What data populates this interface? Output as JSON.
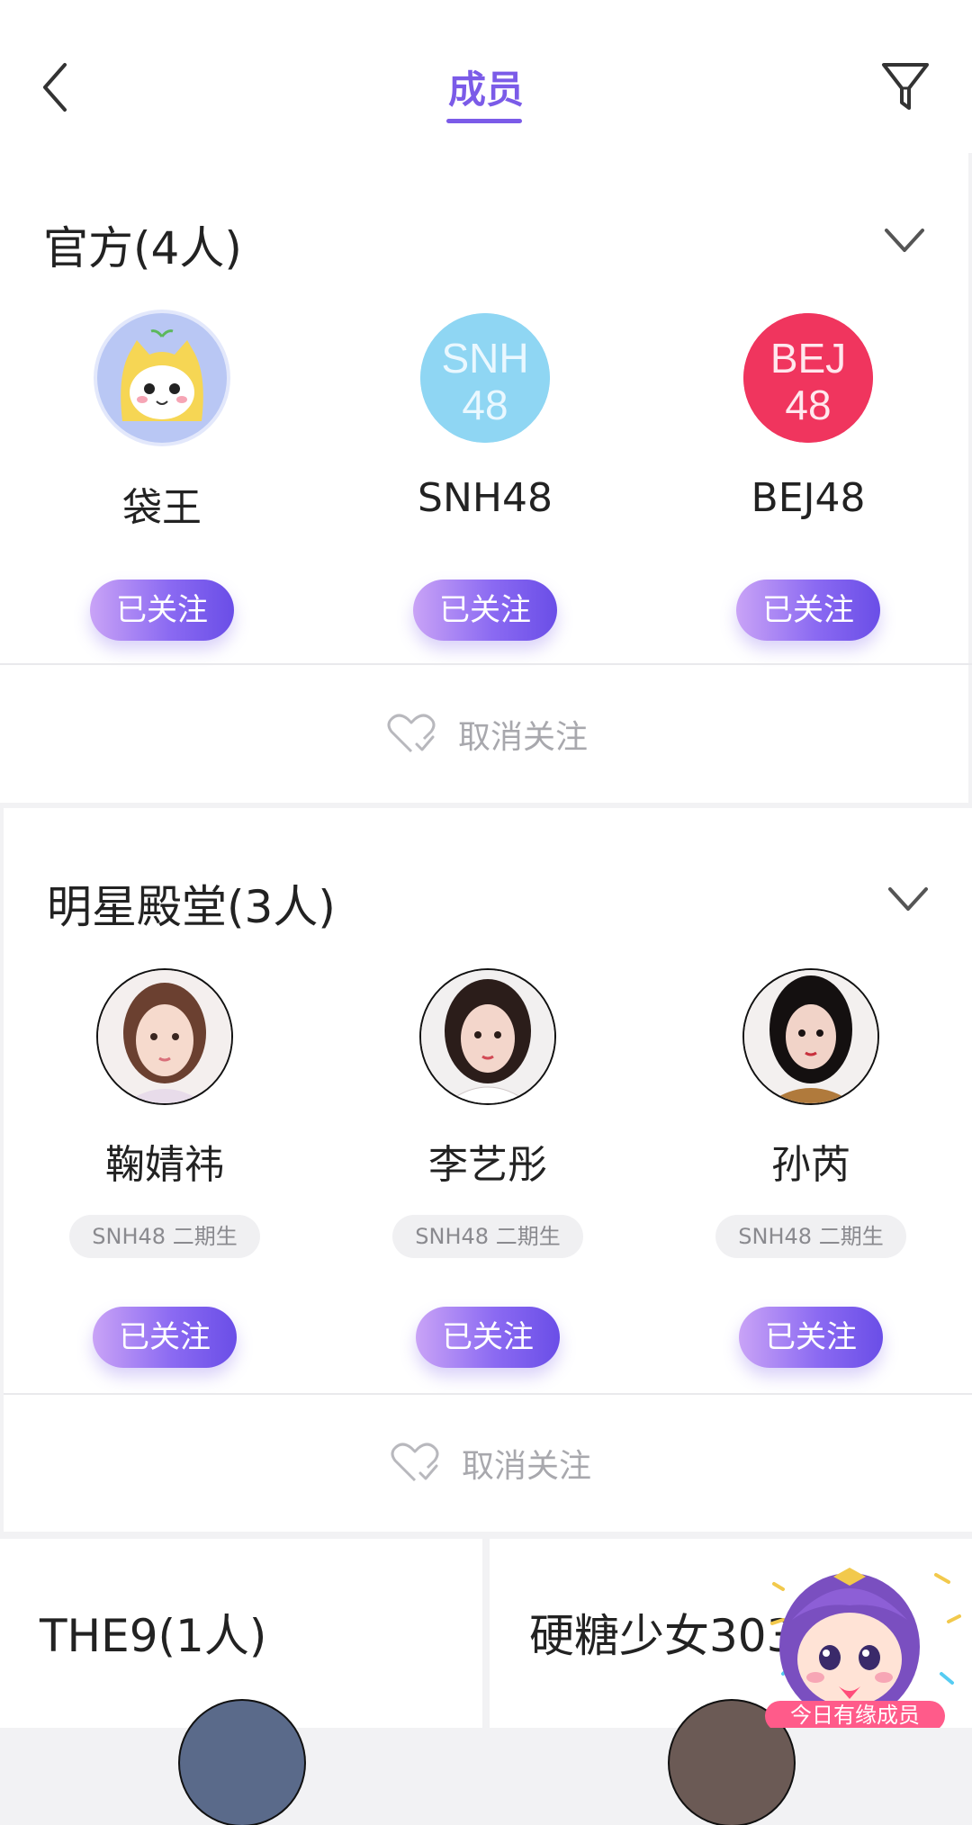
{
  "header": {
    "title": "成员"
  },
  "sections": [
    {
      "title": "官方(4人)",
      "members": [
        {
          "name": "袋王",
          "button": "已关注"
        },
        {
          "name": "SNH48",
          "button": "已关注"
        },
        {
          "name": "BEJ48",
          "button": "已关注"
        }
      ],
      "unfollow": "取消关注"
    },
    {
      "title": "明星殿堂(3人)",
      "members": [
        {
          "name": "鞠婧祎",
          "tag": "SNH48 二期生",
          "button": "已关注"
        },
        {
          "name": "李艺彤",
          "tag": "SNH48 二期生",
          "button": "已关注"
        },
        {
          "name": "孙芮",
          "tag": "SNH48 二期生",
          "button": "已关注"
        }
      ],
      "unfollow": "取消关注"
    }
  ],
  "bottom_cards": [
    {
      "title": "THE9(1人)"
    },
    {
      "title": "硬糖少女303"
    }
  ],
  "logos": {
    "snh": "SNH 48",
    "bej": "BEJ 48"
  },
  "mascot": {
    "label": "今日有缘成员"
  },
  "colors": {
    "accent": "#7b5be8",
    "snh_blue": "#8fd6f3",
    "bej_pink": "#f0355e"
  },
  "icons": [
    "back-icon",
    "filter-icon",
    "chevron-down-icon",
    "heart-check-icon"
  ]
}
